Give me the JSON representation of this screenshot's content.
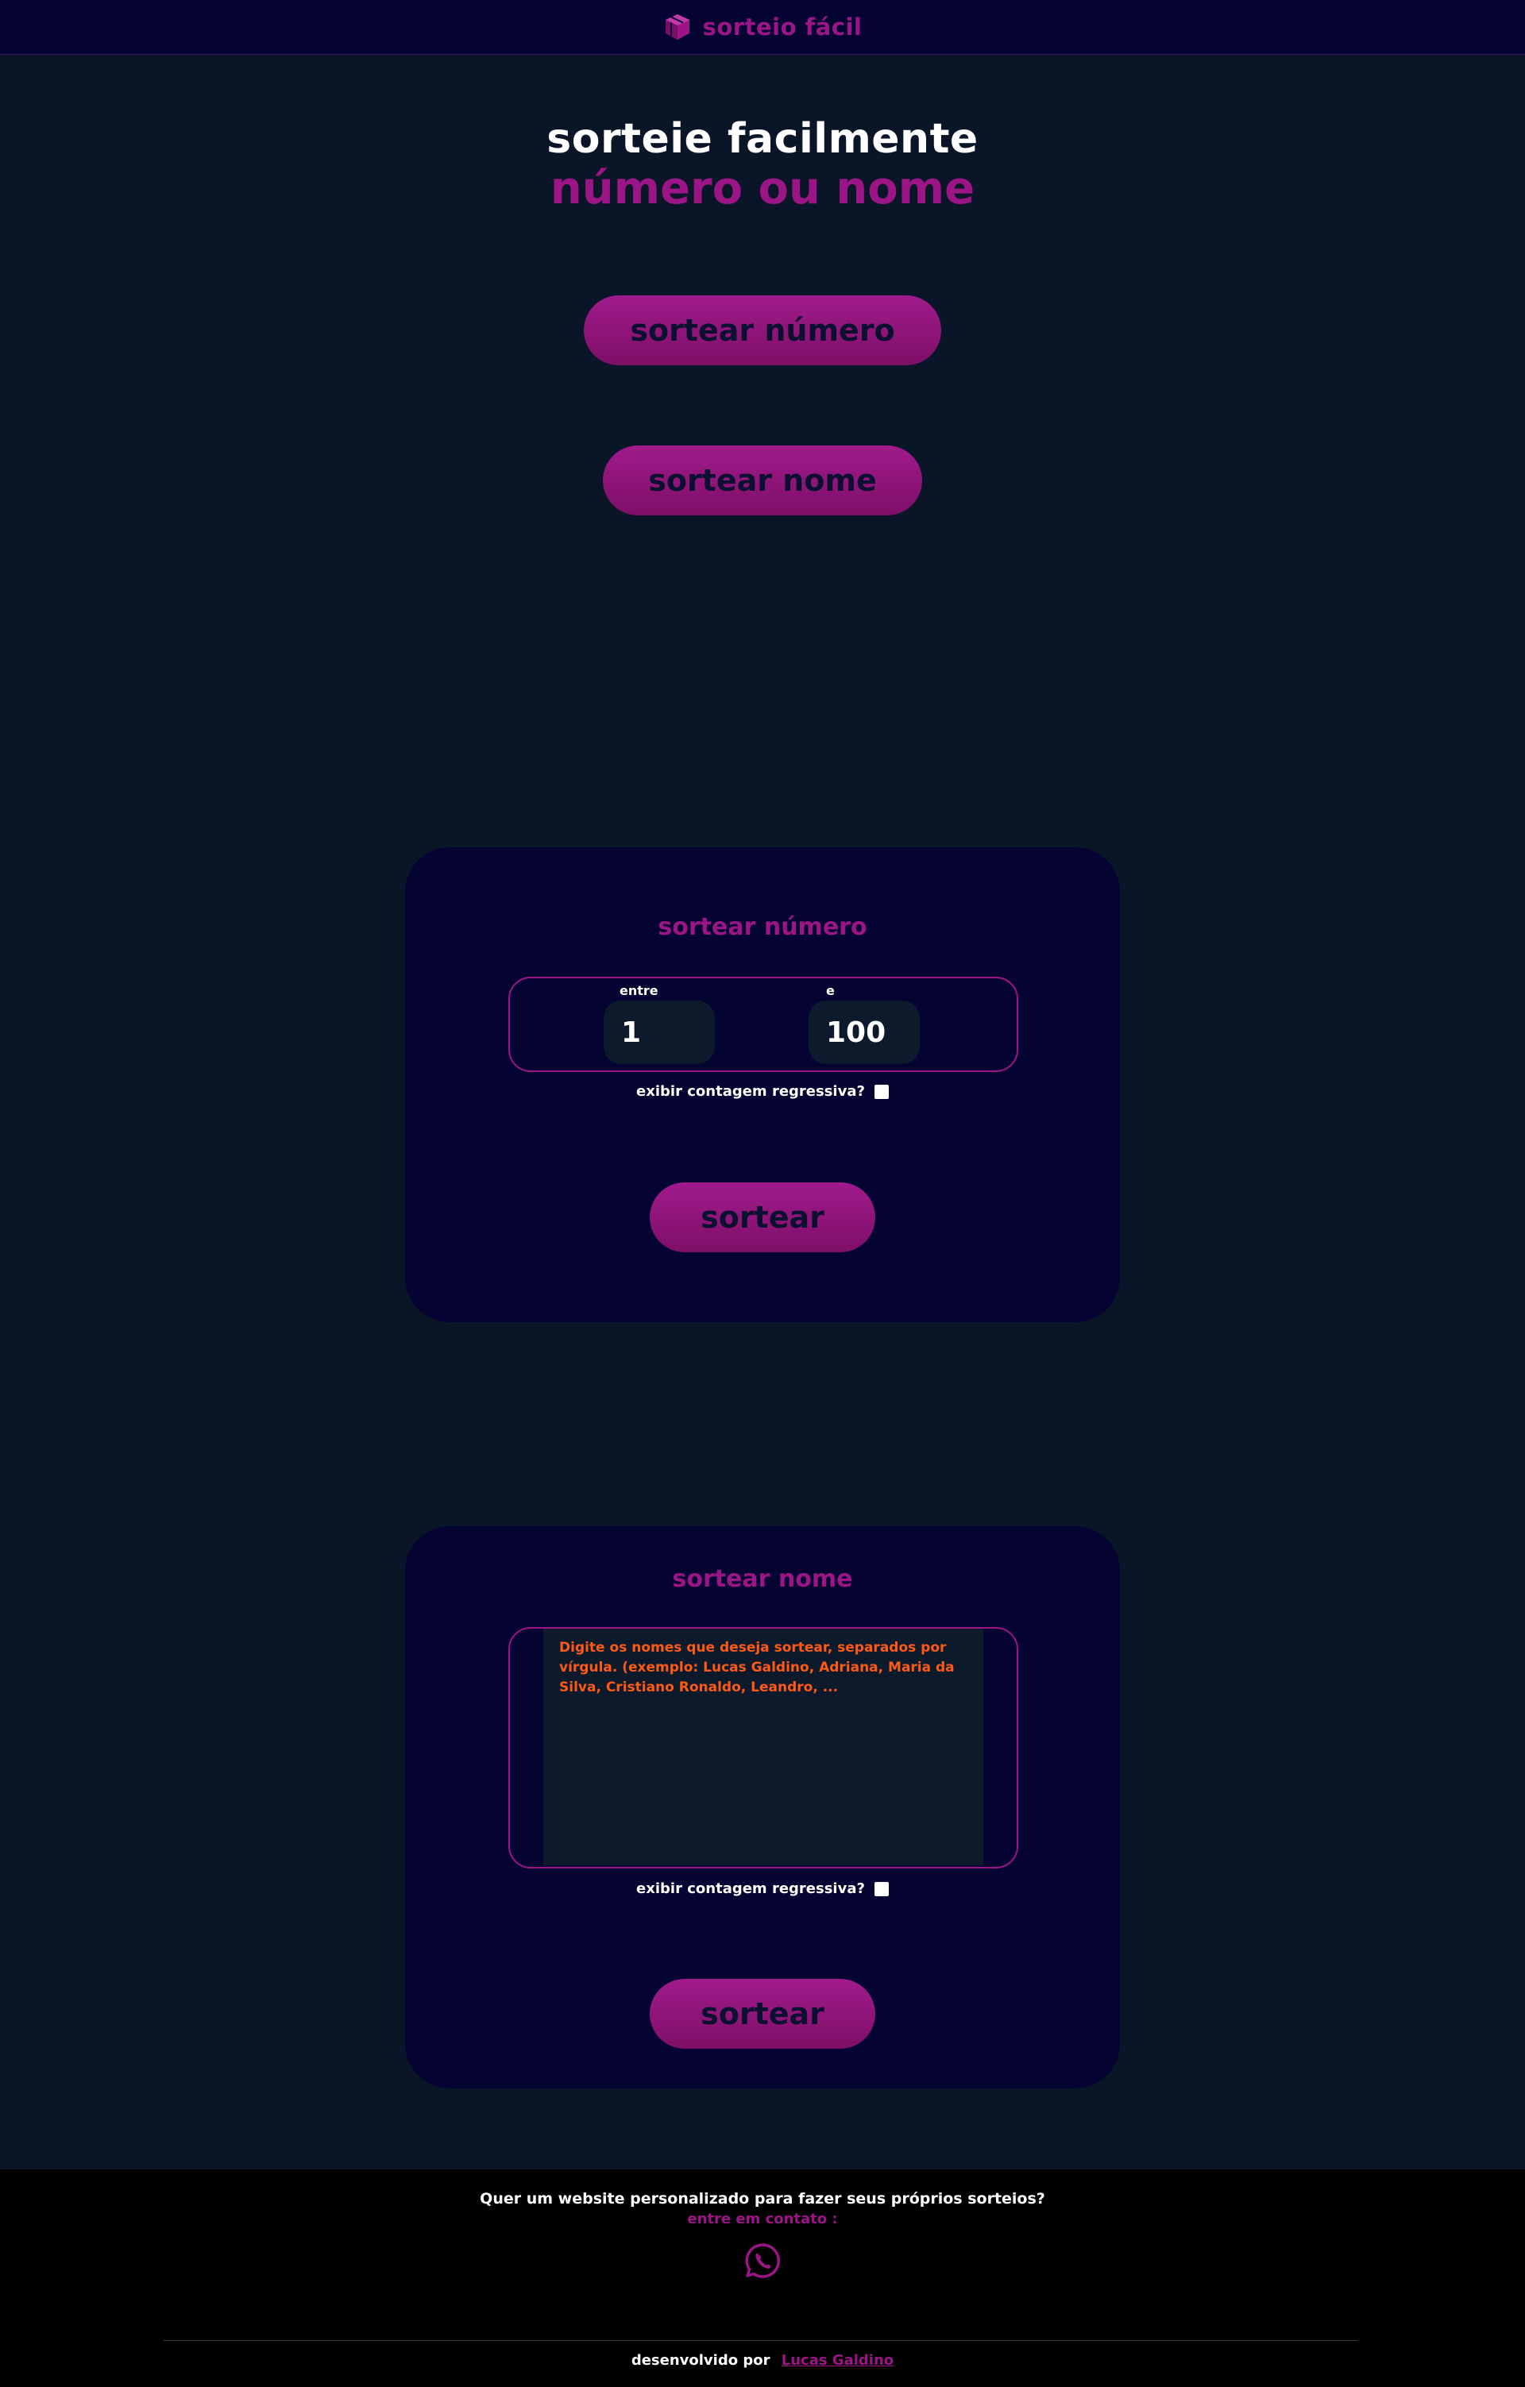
{
  "header": {
    "brand": "sorteio fácil",
    "brand_icon": "cube-icon"
  },
  "hero": {
    "title": "sorteie facilmente",
    "subtitle": "número ou nome"
  },
  "actions": {
    "number_button": "sortear número",
    "name_button": "sortear nome"
  },
  "number_card": {
    "title": "sortear número",
    "from_label": "entre",
    "from_value": "1",
    "to_label": "e",
    "to_value": "100",
    "countdown_label": "exibir contagem regressiva?",
    "countdown_checked": false,
    "submit": "sortear"
  },
  "name_card": {
    "title": "sortear nome",
    "placeholder": "Digite os nomes que deseja sortear, separados por vírgula. (exemplo: Lucas Galdino, Adriana, Maria da Silva, Cristiano Ronaldo, Leandro, ...",
    "countdown_label": "exibir contagem regressiva?",
    "countdown_checked": false,
    "submit": "sortear"
  },
  "footer": {
    "question": "Quer um website personalizado para fazer seus próprios sorteios?",
    "contact": "entre em contato :",
    "contact_icon": "whatsapp-icon",
    "credit_prefix": "desenvolvido por",
    "credit_name": "Lucas Galdino"
  },
  "colors": {
    "accent": "#9b1586",
    "background": "#0a1628",
    "card": "#050332",
    "placeholder": "#ff5a14"
  }
}
